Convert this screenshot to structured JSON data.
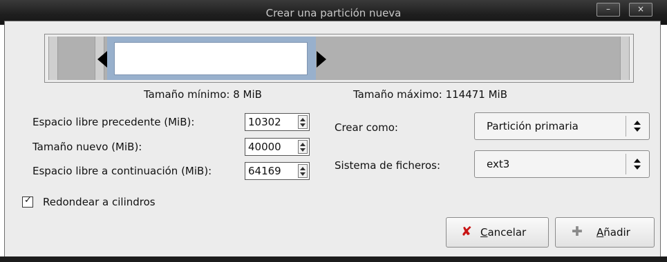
{
  "window": {
    "title": "Crear una partición nueva",
    "minimize_glyph": "–",
    "close_glyph": "×"
  },
  "partition_bar": {
    "min_size_label": "Tamaño mínimo: 8 MiB",
    "max_size_label": "Tamaño máximo: 114471 MiB"
  },
  "fields": {
    "free_before": {
      "label": "Espacio libre precedente (MiB):",
      "value": "10302"
    },
    "new_size": {
      "label": "Tamaño nuevo (MiB):",
      "value": "40000"
    },
    "free_after": {
      "label": "Espacio libre a continuación (MiB):",
      "value": "64169"
    }
  },
  "options": {
    "create_as": {
      "label": "Crear como:",
      "selected": "Partición primaria"
    },
    "filesystem": {
      "label": "Sistema de ficheros:",
      "selected": "ext3"
    }
  },
  "round_cylinders": {
    "label": "Redondear a cilindros",
    "checked": true,
    "mark": "✓"
  },
  "buttons": {
    "cancel": {
      "prefix_underlined": "C",
      "rest": "ancelar",
      "icon": "cancel-icon",
      "glyph": "✘",
      "color": "#c81414"
    },
    "add": {
      "prefix_underlined": "A",
      "rest": "ñadir",
      "icon": "add-icon",
      "glyph": "✚"
    }
  }
}
